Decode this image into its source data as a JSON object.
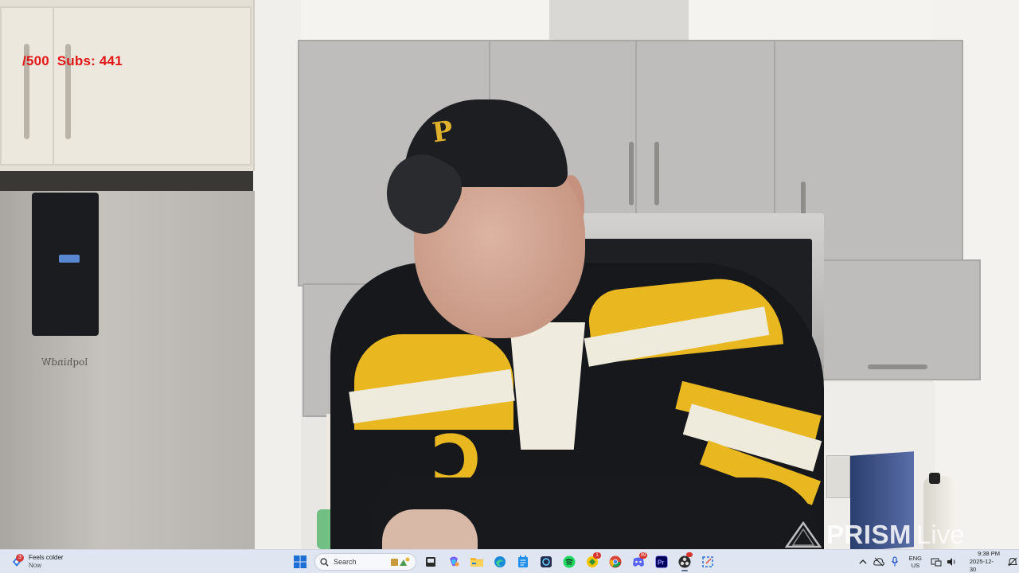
{
  "overlay": {
    "subscriber_counter": "/500  Subs: 441"
  },
  "watermark": {
    "brand": "PRISM",
    "suffix": "Live"
  },
  "taskbar": {
    "weather": {
      "title": "Feels colder",
      "subtitle": "Now",
      "badge": "3",
      "icon": "weather-alert-icon"
    },
    "search": {
      "placeholder": "Search"
    },
    "pinned_apps": [
      {
        "name": "windows-start-icon",
        "active": false
      },
      {
        "name": "search-box",
        "active": false
      },
      {
        "name": "widgets-icon",
        "active": false
      },
      {
        "name": "task-view-icon",
        "active": false
      },
      {
        "name": "copilot-icon",
        "active": false
      },
      {
        "name": "file-explorer-icon",
        "active": false
      },
      {
        "name": "edge-browser-icon",
        "active": false
      },
      {
        "name": "notepad-icon",
        "active": false
      },
      {
        "name": "app-dark-icon",
        "active": false
      },
      {
        "name": "spotify-icon",
        "active": false
      },
      {
        "name": "notification-app-icon",
        "badge": "1",
        "active": false
      },
      {
        "name": "chrome-icon",
        "active": false
      },
      {
        "name": "discord-icon",
        "badge": "99",
        "active": false
      },
      {
        "name": "premiere-pro-icon",
        "active": false
      },
      {
        "name": "obs-icon",
        "badge": "",
        "active": true
      },
      {
        "name": "snipping-tool-icon",
        "active": false
      }
    ],
    "premiere_label": "Pr",
    "tray": {
      "language": "ENG",
      "region": "US",
      "time": "9:38 PM",
      "date": "2025-12-30"
    }
  },
  "colors": {
    "counter_red": "#e31616",
    "taskbar_bg": "#dfe6f1",
    "jersey_yellow": "#e9b820"
  }
}
